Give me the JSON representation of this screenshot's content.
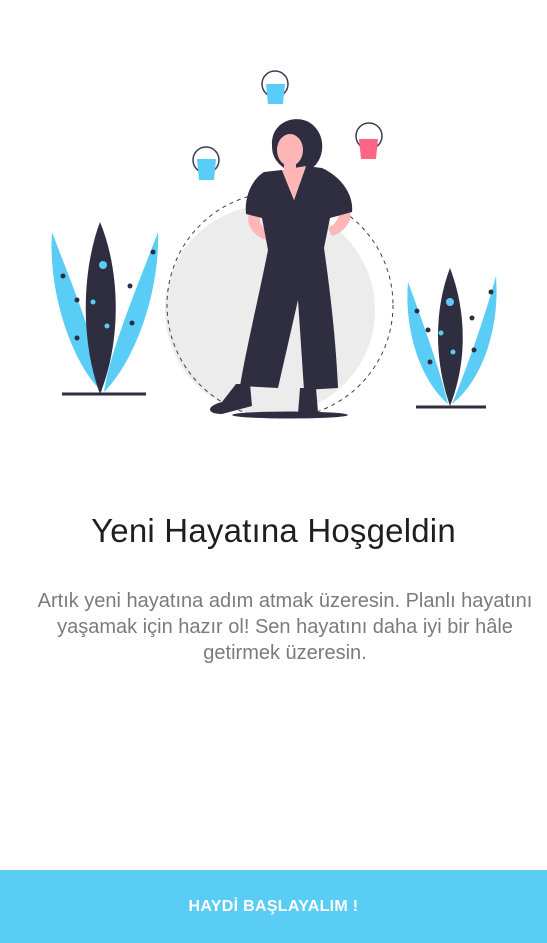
{
  "welcome": {
    "title": "Yeni Hayatına Hoşgeldin",
    "description": "Artık yeni hayatına adım atmak üzeresin. Planlı hayatını yaşamak için hazır ol! Sen hayatını daha iyi bir hâle getirmek üzeresin."
  },
  "actions": {
    "start_label": "HAYDİ BAŞLAYALIM !"
  },
  "illustration": {
    "name": "woman-juggling-illustration",
    "colors": {
      "accent": "#5acdf7",
      "dark": "#2f2e41",
      "skin": "#ffb6b6",
      "pink": "#ff6584",
      "circle": "#ececec"
    }
  },
  "colors": {
    "button_background": "#5acdf7",
    "button_text": "#ffffff",
    "title_text": "#1f1f1f",
    "body_text": "#7b7b7b"
  }
}
